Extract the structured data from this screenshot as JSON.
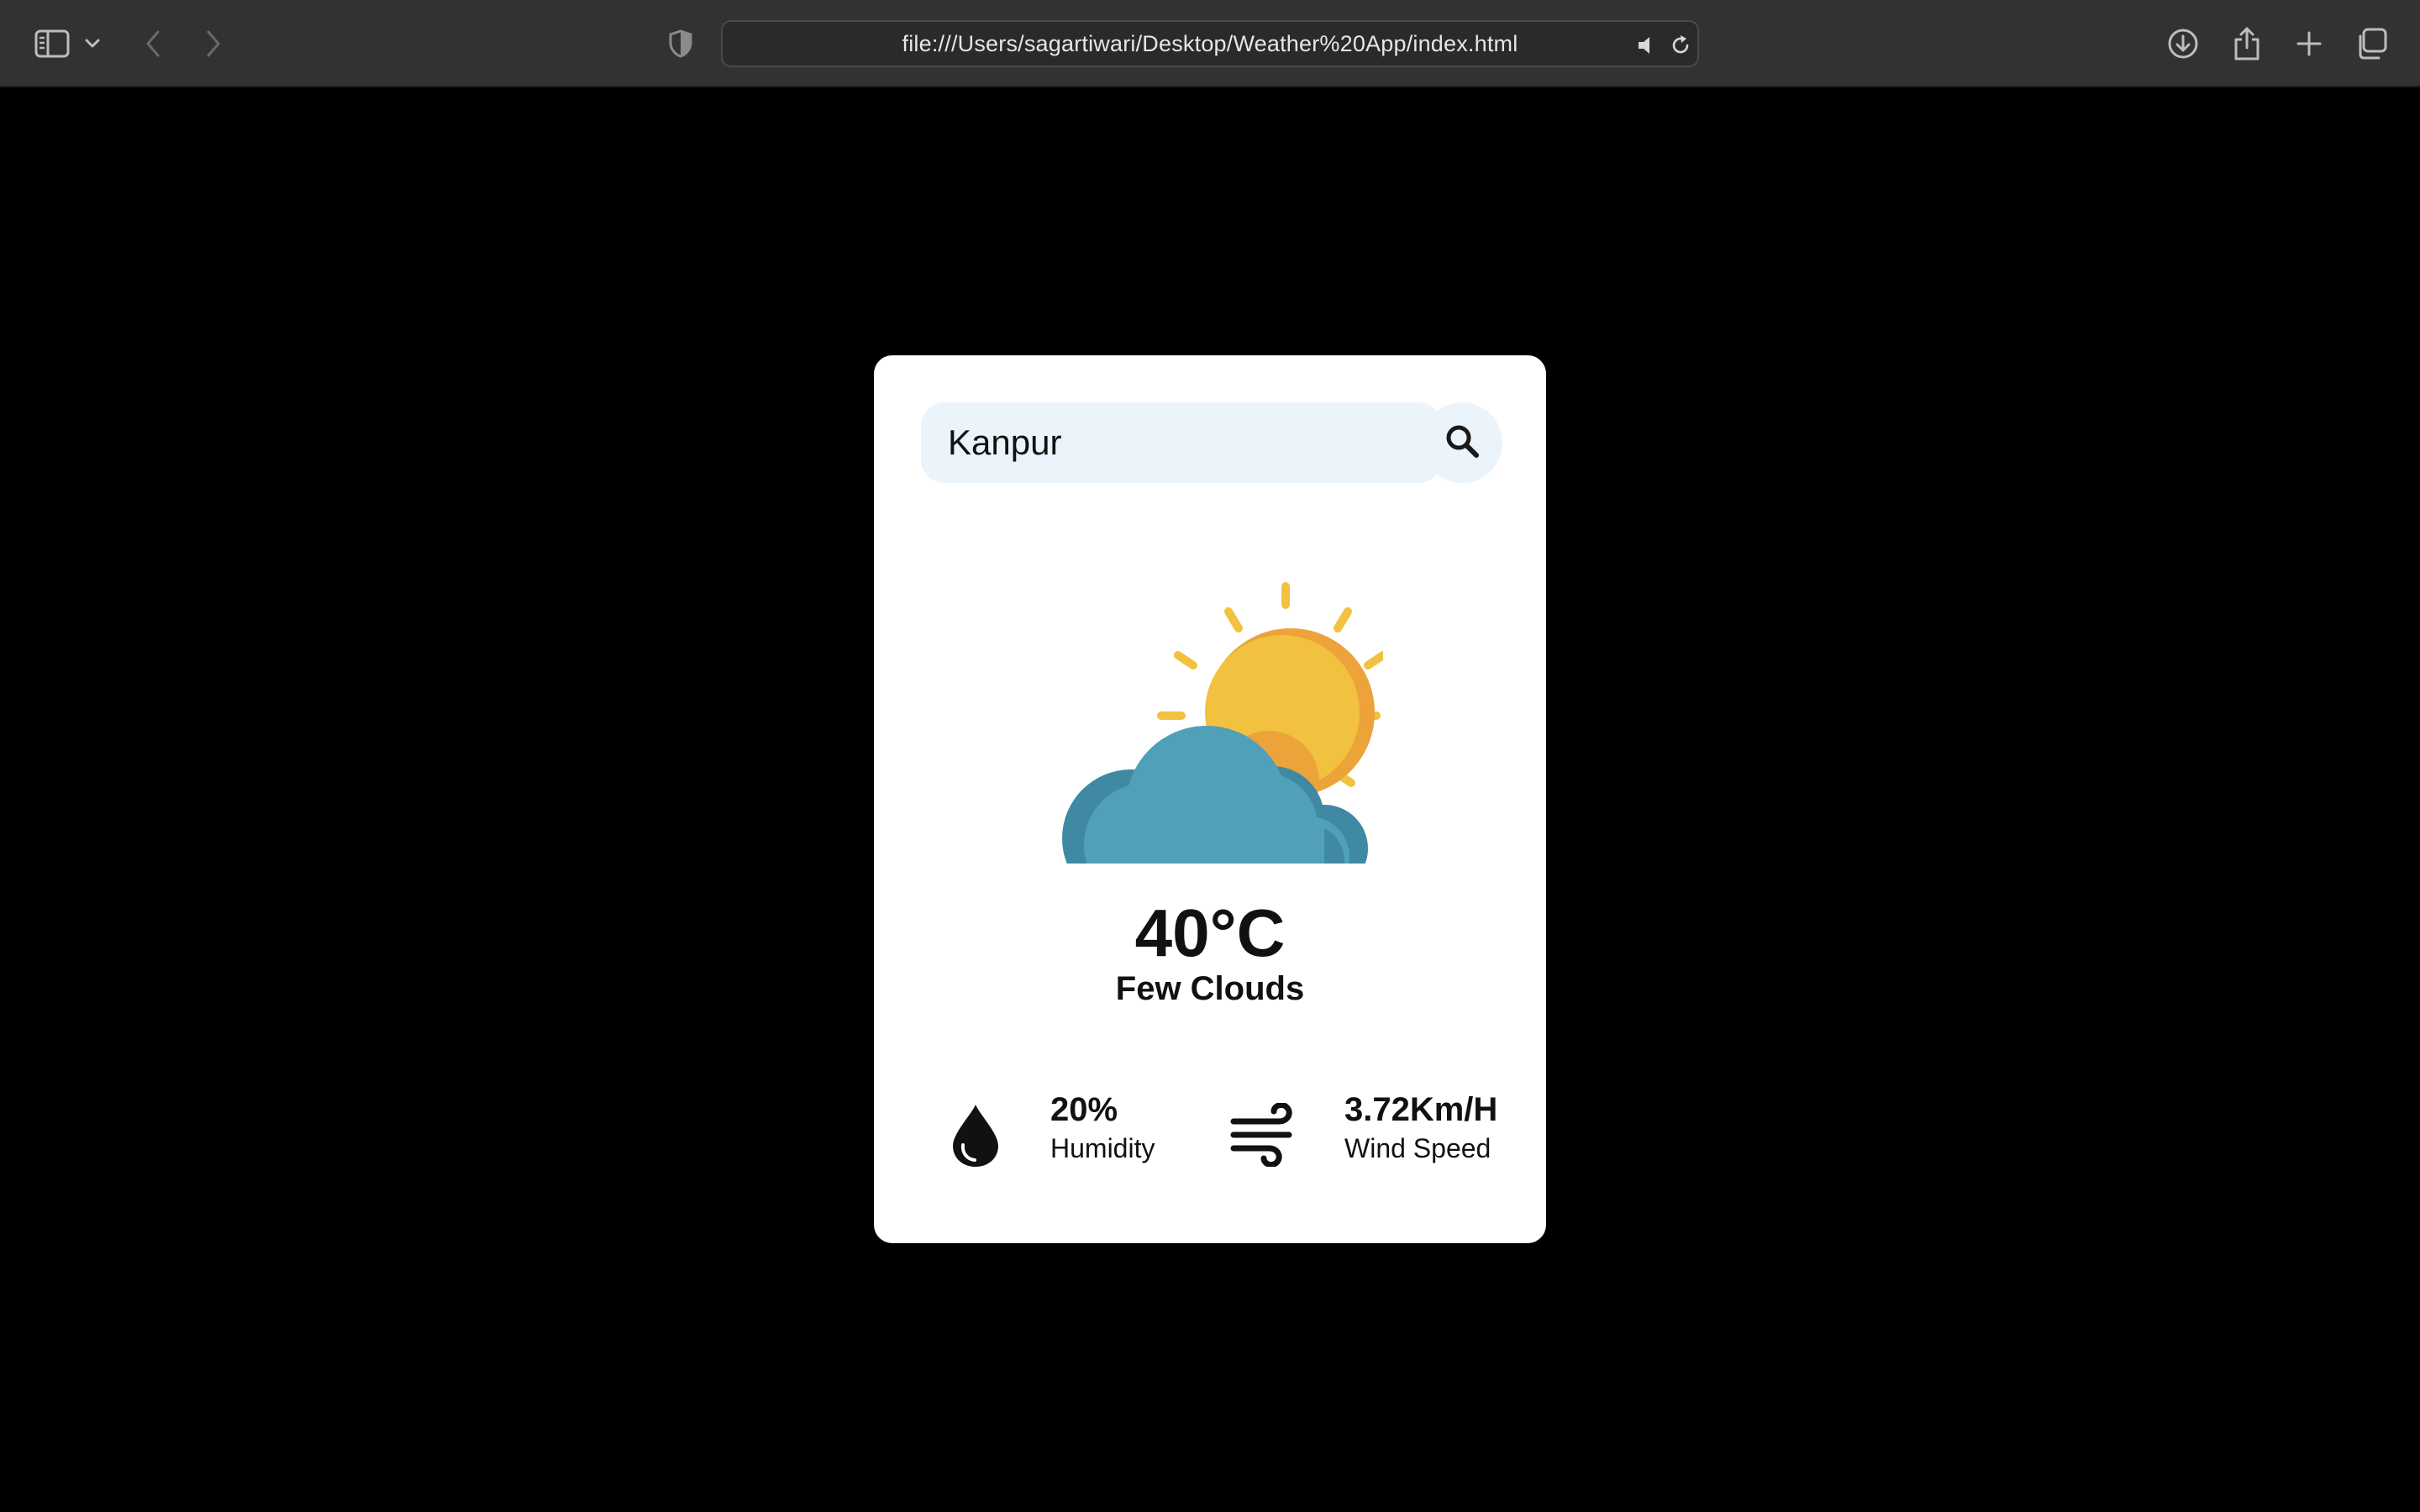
{
  "browser": {
    "url": "file:///Users/sagartiwari/Desktop/Weather%20App/index.html",
    "icons": {
      "sidebar": "sidebar-icon",
      "sidebar_menu": "chevron-down-icon",
      "back": "chevron-left-icon",
      "forward": "chevron-right-icon",
      "privacy": "shield-icon",
      "mute": "speaker-icon",
      "reload": "reload-icon",
      "downloads": "download-icon",
      "share": "share-icon",
      "new_tab": "plus-icon",
      "tab_overview": "tabs-icon"
    }
  },
  "search": {
    "value": "Kanpur",
    "button_icon": "search-icon"
  },
  "weather": {
    "icon": "sun-behind-cloud-icon",
    "temperature": "40°C",
    "condition": "Few Clouds"
  },
  "details": {
    "humidity": {
      "value": "20%",
      "label": "Humidity",
      "icon": "water-drop-icon"
    },
    "wind": {
      "value": "3.72Km/H",
      "label": "Wind Speed",
      "icon": "wind-icon"
    }
  },
  "colors": {
    "page_background": "#000000",
    "card_background": "#ffffff",
    "input_background": "#ebf4fb",
    "toolbar_background": "#323232",
    "sun": "#f2c13f",
    "sun_shade": "#eca33a",
    "cloud": "#50a0b9",
    "cloud_shade": "#3f89a2"
  }
}
